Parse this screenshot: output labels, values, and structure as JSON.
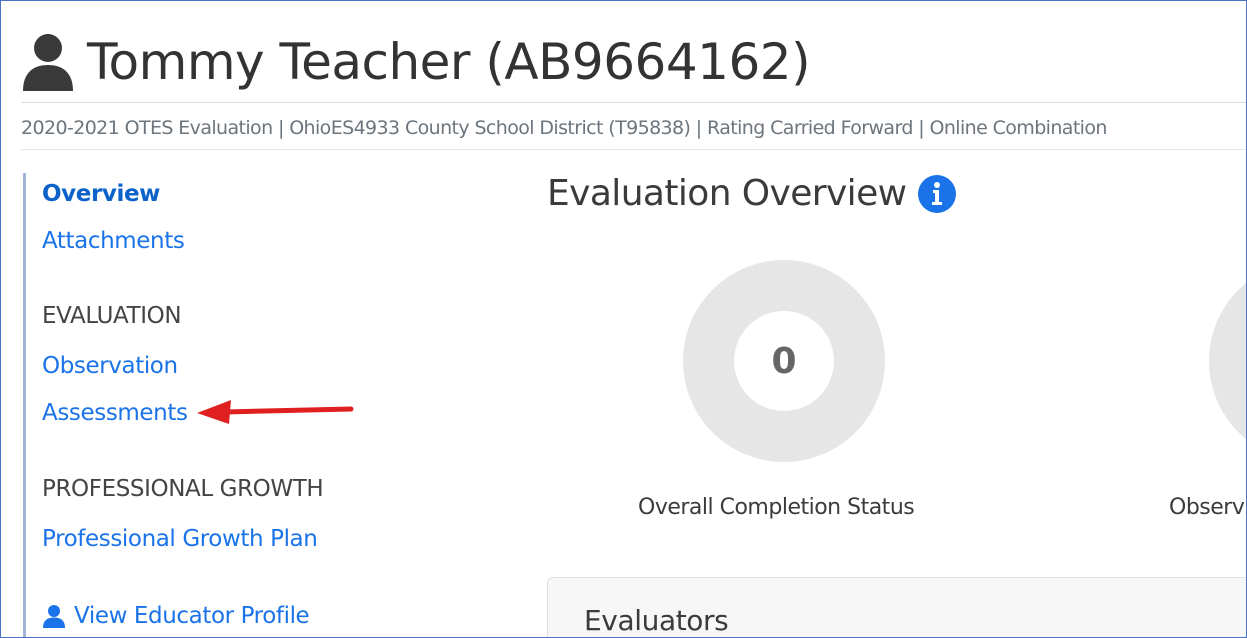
{
  "header": {
    "title": "Tommy Teacher (AB9664162)"
  },
  "subtitle": "2020-2021 OTES Evaluation | OhioES4933 County School District (T95838) | Rating Carried Forward | Online Combination",
  "sidebar": {
    "links_top": [
      {
        "label": "Overview",
        "active": true
      },
      {
        "label": "Attachments",
        "active": false
      }
    ],
    "evaluation_heading": "EVALUATION",
    "evaluation_links": [
      {
        "label": "Observation"
      },
      {
        "label": "Assessments"
      }
    ],
    "growth_heading": "PROFESSIONAL GROWTH",
    "growth_links": [
      {
        "label": "Professional Growth Plan"
      }
    ],
    "profile_link": "View Educator Profile"
  },
  "main": {
    "heading": "Evaluation Overview",
    "donuts": [
      {
        "value": "0",
        "label": "Overall Completion Status"
      },
      {
        "value": "",
        "label": "Observ"
      }
    ],
    "panel_title": "Evaluators"
  },
  "colors": {
    "link": "#1a73e8",
    "annotation_arrow": "#e02020",
    "sidebar_border": "#9fb4d6",
    "donut_ring": "#e6e6e6"
  }
}
